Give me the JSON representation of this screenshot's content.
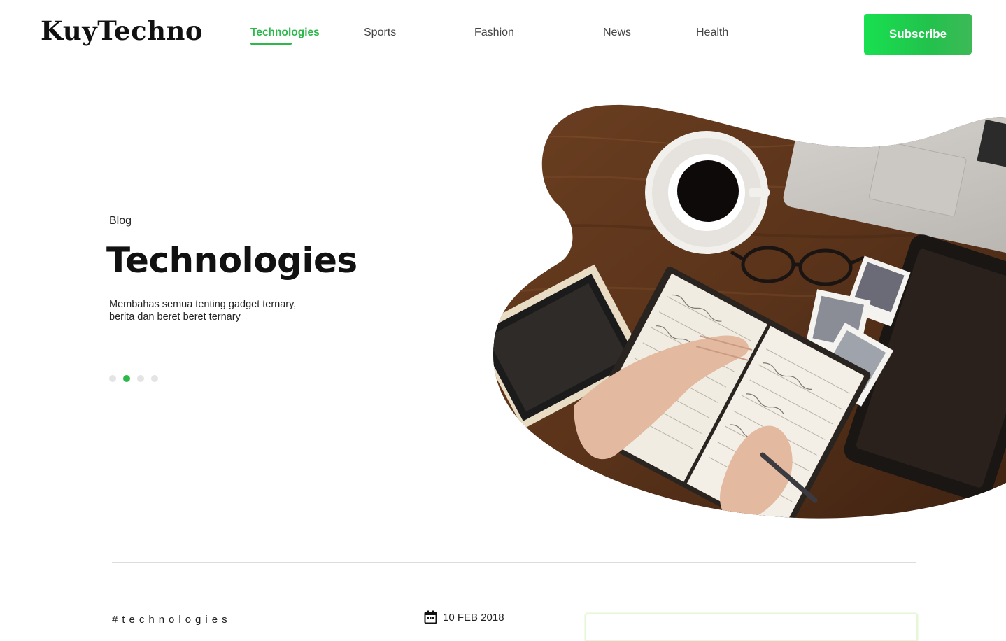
{
  "header": {
    "logo": "KuyTechno",
    "nav": [
      {
        "label": "Technologies",
        "active": true
      },
      {
        "label": "Sports",
        "active": false
      },
      {
        "label": "Fashion",
        "active": false
      },
      {
        "label": "News",
        "active": false
      },
      {
        "label": "Health",
        "active": false
      }
    ],
    "subscribe_label": "Subscribe"
  },
  "hero": {
    "eyebrow": "Blog",
    "title": "Technologies",
    "description_line1": "Membahas semua tenting gadget ternary,",
    "description_line2": "berita dan beret beret ternary",
    "slides_total": 4,
    "active_slide_index": 1,
    "image_icon": "desk-workspace-photo"
  },
  "post": {
    "tag": "#technologies",
    "date": "10 FEB 2018",
    "date_icon": "calendar-icon"
  },
  "colors": {
    "accent": "#2cb84b",
    "subscribe_gradient_start": "#18e050",
    "subscribe_gradient_end": "#3db957",
    "dot_inactive": "#e4e4e4"
  }
}
